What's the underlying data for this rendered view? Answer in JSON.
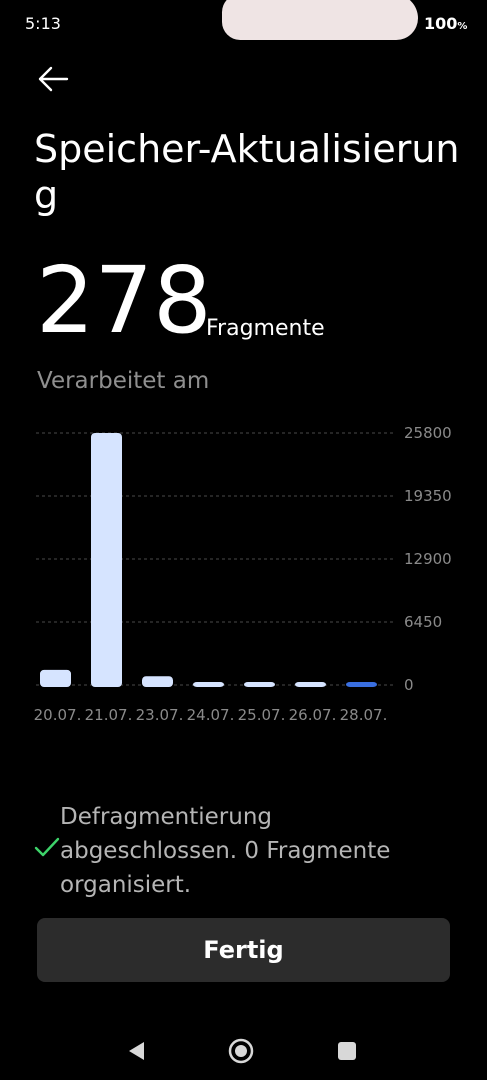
{
  "status_bar": {
    "time": "5:13",
    "battery": "100",
    "battery_unit": "%"
  },
  "header": {
    "title": "Speicher-Aktualisierung"
  },
  "summary": {
    "count": "278",
    "unit": "Fragmente"
  },
  "chart_section": {
    "label": "Verarbeitet am"
  },
  "chart_data": {
    "type": "bar",
    "categories": [
      "20.07.",
      "21.07.",
      "23.07.",
      "24.07.",
      "25.07.",
      "26.07.",
      "28.07."
    ],
    "values": [
      1550,
      25800,
      900,
      278,
      60,
      60,
      278
    ],
    "ylim": [
      0,
      25800
    ],
    "yticks": [
      "25800",
      "19350",
      "12900",
      "6450",
      "0"
    ],
    "grid": true,
    "bar_color": "#d6e4ff",
    "highlight_color": "#3a6fe0",
    "highlight_index": 6
  },
  "result": {
    "message": "Defragmentierung abgeschlossen. 0 Fragmente organisiert.",
    "icon": "check-icon",
    "accent": "#3dd36a"
  },
  "actions": {
    "done_label": "Fertig"
  },
  "nav": {
    "back": "back-triangle-icon",
    "home": "home-circle-icon",
    "recents": "recents-square-icon"
  }
}
